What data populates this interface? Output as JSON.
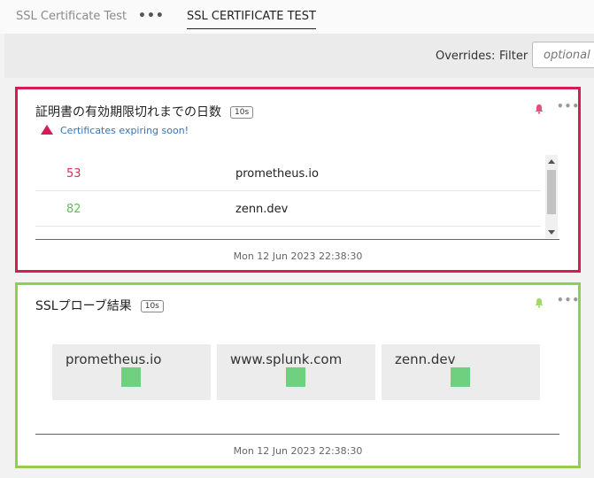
{
  "header": {
    "tabs": [
      {
        "label": "SSL Certificate Test"
      },
      {
        "label": "SSL CERTIFICATE TEST"
      }
    ],
    "more_icon": "more-dots-icon"
  },
  "overrides": {
    "label": "Overrides:",
    "filter_label": "Filter",
    "filter_placeholder": "optional"
  },
  "panels": [
    {
      "title": "証明書の有効期限切れまでの日数",
      "interval": "10s",
      "border_color": "#d41c55",
      "alert_text": "Certificates expiring soon!",
      "rows": [
        {
          "value": "53",
          "host": "prometheus.io",
          "color": "#d9304f"
        },
        {
          "value": "82",
          "host": "zenn.dev",
          "color": "#5fbf55"
        }
      ],
      "timestamp": "Mon 12 Jun 2023 22:38:30"
    },
    {
      "title": "SSLプローブ結果",
      "interval": "10s",
      "border_color": "#93cf4c",
      "probes": [
        {
          "name": "prometheus.io",
          "status_color": "#6fd07f"
        },
        {
          "name": "www.splunk.com",
          "status_color": "#6fd07f"
        },
        {
          "name": "zenn.dev",
          "status_color": "#6fd07f"
        }
      ],
      "timestamp": "Mon 12 Jun 2023 22:38:30"
    }
  ]
}
